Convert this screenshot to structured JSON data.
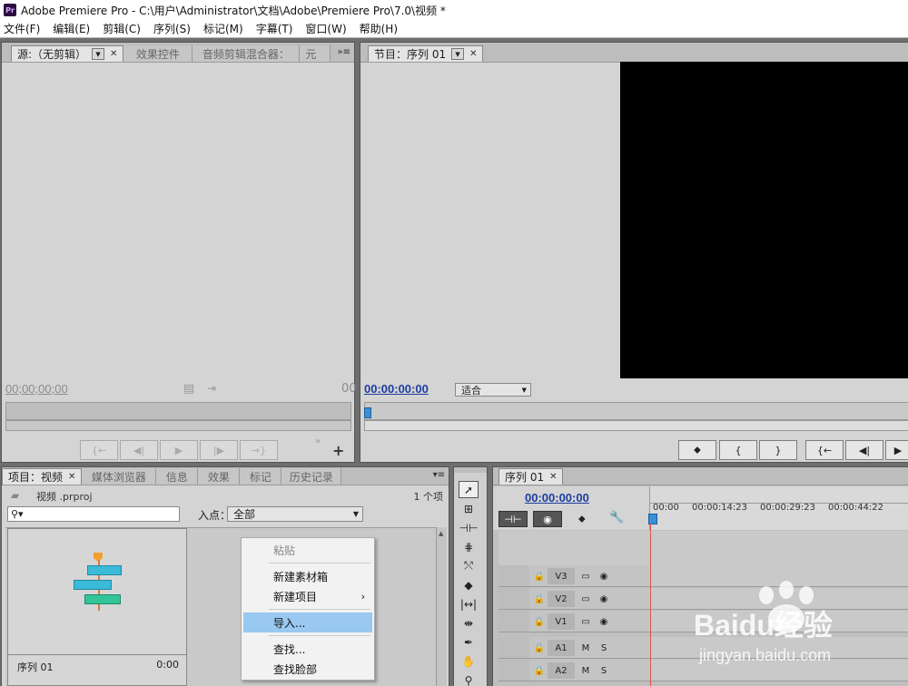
{
  "window": {
    "app_icon": "Pr",
    "title": "Adobe Premiere Pro - C:\\用户\\Administrator\\文档\\Adobe\\Premiere Pro\\7.0\\视频 *"
  },
  "menu": [
    "文件(F)",
    "编辑(E)",
    "剪辑(C)",
    "序列(S)",
    "标记(M)",
    "字幕(T)",
    "窗口(W)",
    "帮助(H)"
  ],
  "source_panel": {
    "tabs": [
      "源:（无剪辑）",
      "效果控件",
      "音频剪辑混合器：",
      "元"
    ],
    "timecode": "00;00;00;00",
    "right_timecode": "00"
  },
  "program_panel": {
    "tab": "节目：序列 01",
    "timecode": "00:00:00:00",
    "fit_label": "适合"
  },
  "project_panel": {
    "tabs": [
      "项目：视频",
      "媒体浏览器",
      "信息",
      "效果",
      "标记",
      "历史记录"
    ],
    "file_name": "视频 .prproj",
    "item_count": "1 个项",
    "search_placeholder": "",
    "in_point_label": "入点：",
    "in_point_value": "全部",
    "sequence_name": "序列 01",
    "sequence_duration": "0:00"
  },
  "context_menu": {
    "items": [
      "粘贴",
      "新建素材箱",
      "新建项目",
      "导入...",
      "查找...",
      "查找脸部"
    ]
  },
  "timeline_panel": {
    "tab": "序列 01",
    "timecode": "00:00:00:00",
    "ruler": [
      "00:00",
      "00:00:14:23",
      "00:00:29:23",
      "00:00:44:22"
    ],
    "video_tracks": [
      "V3",
      "V2",
      "V1"
    ],
    "audio_tracks": [
      "A1",
      "A2"
    ],
    "mute_label": "M",
    "solo_label": "S"
  },
  "watermark": {
    "brand": "Baidu经验",
    "url": "jingyan.baidu.com"
  },
  "colors": {
    "timecode_blue": "#1e3ea0",
    "playhead": "#d9534f",
    "menu_highlight": "#99c8f0",
    "clip_cyan": "#3cbbd8",
    "clip_green": "#34c49a",
    "marker_orange": "#f0a030"
  }
}
